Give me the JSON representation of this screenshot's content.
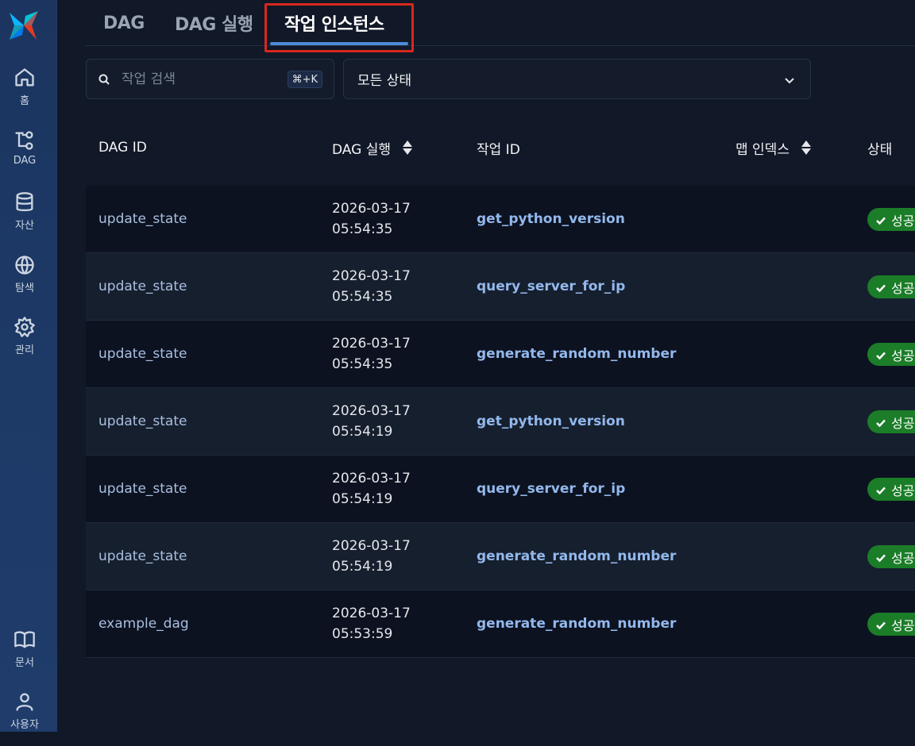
{
  "sidebar": {
    "items": [
      {
        "label": "홈",
        "icon": "home-icon"
      },
      {
        "label": "DAG",
        "icon": "dag-icon"
      },
      {
        "label": "자산",
        "icon": "database-icon"
      },
      {
        "label": "탐색",
        "icon": "globe-icon"
      },
      {
        "label": "관리",
        "icon": "gear-icon"
      },
      {
        "label": "문서",
        "icon": "book-icon"
      },
      {
        "label": "사용자",
        "icon": "user-icon"
      }
    ]
  },
  "tabs": [
    {
      "label": "DAG"
    },
    {
      "label": "DAG 실행"
    },
    {
      "label": "작업 인스턴스",
      "active": true
    }
  ],
  "filters": {
    "search_placeholder": "작업 검색",
    "shortcut": "⌘+K",
    "state_select": "모든 상태"
  },
  "table": {
    "headers": {
      "dag_id": "DAG ID",
      "dag_run": "DAG 실행",
      "task_id": "작업 ID",
      "map_index": "맵 인덱스",
      "state": "상태"
    },
    "rows": [
      {
        "dag_id": "update_state",
        "date": "2026-03-17",
        "time": "05:54:35",
        "task_id": "get_python_version",
        "state": "성공"
      },
      {
        "dag_id": "update_state",
        "date": "2026-03-17",
        "time": "05:54:35",
        "task_id": "query_server_for_ip",
        "state": "성공"
      },
      {
        "dag_id": "update_state",
        "date": "2026-03-17",
        "time": "05:54:35",
        "task_id": "generate_random_number",
        "state": "성공"
      },
      {
        "dag_id": "update_state",
        "date": "2026-03-17",
        "time": "05:54:19",
        "task_id": "get_python_version",
        "state": "성공"
      },
      {
        "dag_id": "update_state",
        "date": "2026-03-17",
        "time": "05:54:19",
        "task_id": "query_server_for_ip",
        "state": "성공"
      },
      {
        "dag_id": "update_state",
        "date": "2026-03-17",
        "time": "05:54:19",
        "task_id": "generate_random_number",
        "state": "성공"
      },
      {
        "dag_id": "example_dag",
        "date": "2026-03-17",
        "time": "05:53:59",
        "task_id": "generate_random_number",
        "state": "성공"
      }
    ]
  },
  "colors": {
    "accent": "#4f8ad8",
    "highlight": "#d6281e",
    "success": "#1b7d28"
  }
}
